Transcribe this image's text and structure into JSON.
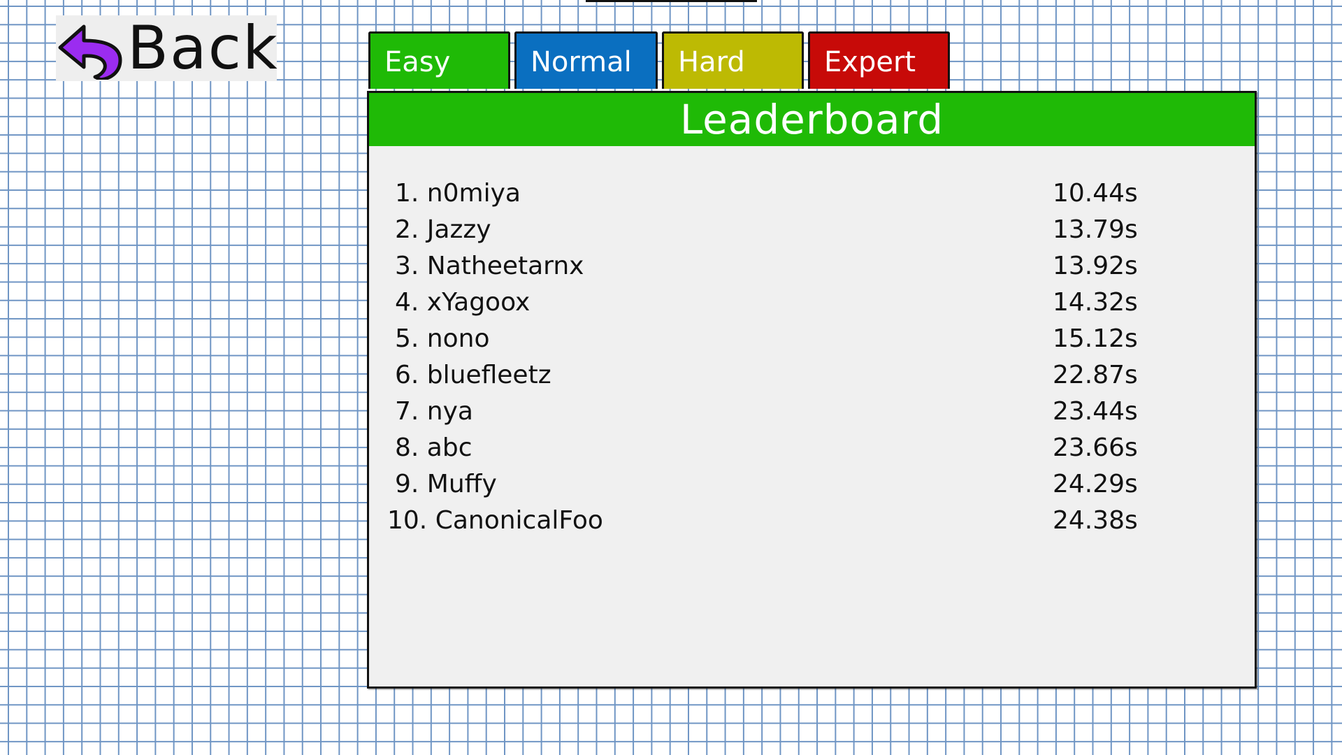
{
  "back": {
    "label": "Back",
    "icon": "curved-back-arrow-icon",
    "icon_color": "#9b2cf0"
  },
  "tabs": [
    {
      "label": "Easy",
      "color": "#1fba06"
    },
    {
      "label": "Normal",
      "color": "#0a6fc0"
    },
    {
      "label": "Hard",
      "color": "#bdba03"
    },
    {
      "label": "Expert",
      "color": "#c70a08"
    }
  ],
  "leaderboard": {
    "title": "Leaderboard",
    "entries": [
      {
        "name": "1. n0miya",
        "time": "10.44s"
      },
      {
        "name": "2. Jazzy",
        "time": "13.79s"
      },
      {
        "name": "3. Natheetarnx",
        "time": "13.92s"
      },
      {
        "name": "4. xYagoox",
        "time": "14.32s"
      },
      {
        "name": "5. nono",
        "time": "15.12s"
      },
      {
        "name": "6. bluefleetz",
        "time": "22.87s"
      },
      {
        "name": "7. nya",
        "time": "23.44s"
      },
      {
        "name": "8. abc",
        "time": "23.66s"
      },
      {
        "name": "9. Muffy",
        "time": "24.29s"
      },
      {
        "name": "10. CanonicalFoo",
        "time": "24.38s"
      }
    ]
  }
}
